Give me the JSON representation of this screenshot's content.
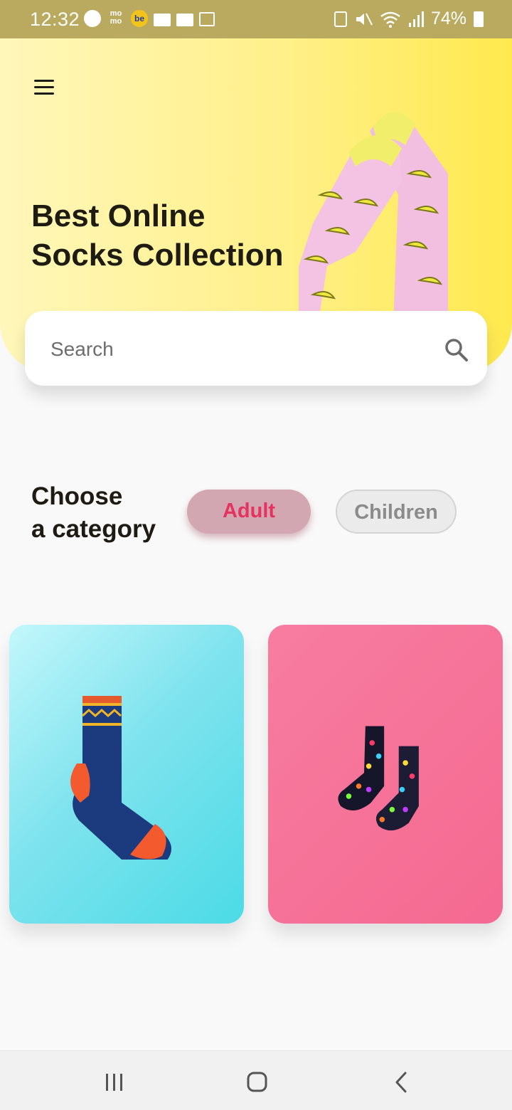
{
  "status_bar": {
    "time": "12:32",
    "battery": "74%",
    "left_icons": [
      "messenger-icon",
      "momo-icon",
      "be-icon",
      "folder-icon",
      "folder-icon",
      "image-icon"
    ],
    "right_icons": [
      "battery-saver-icon",
      "mute-icon",
      "wifi-icon",
      "signal-icon",
      "battery-icon"
    ],
    "momo_text": "mo mo",
    "be_text": "be"
  },
  "hero": {
    "title_line1": "Best Online",
    "title_line2": "Socks Collection",
    "gradient_colors": [
      "#fff7ba",
      "#ffe94e"
    ]
  },
  "search": {
    "placeholder": "Search",
    "value": ""
  },
  "category": {
    "title_line1": "Choose",
    "title_line2": "a category",
    "chips": [
      {
        "label": "Adult",
        "selected": true
      },
      {
        "label": "Children",
        "selected": false
      }
    ],
    "accent_color": "#e5335f"
  },
  "products": [
    {
      "image": "blue-orange-sock",
      "card_color": "#4bdbe6"
    },
    {
      "image": "colorful-cat-socks-pair",
      "card_color": "#f56991"
    }
  ],
  "nav_bar": {
    "buttons": [
      "recent-apps-icon",
      "home-icon",
      "back-icon"
    ]
  }
}
